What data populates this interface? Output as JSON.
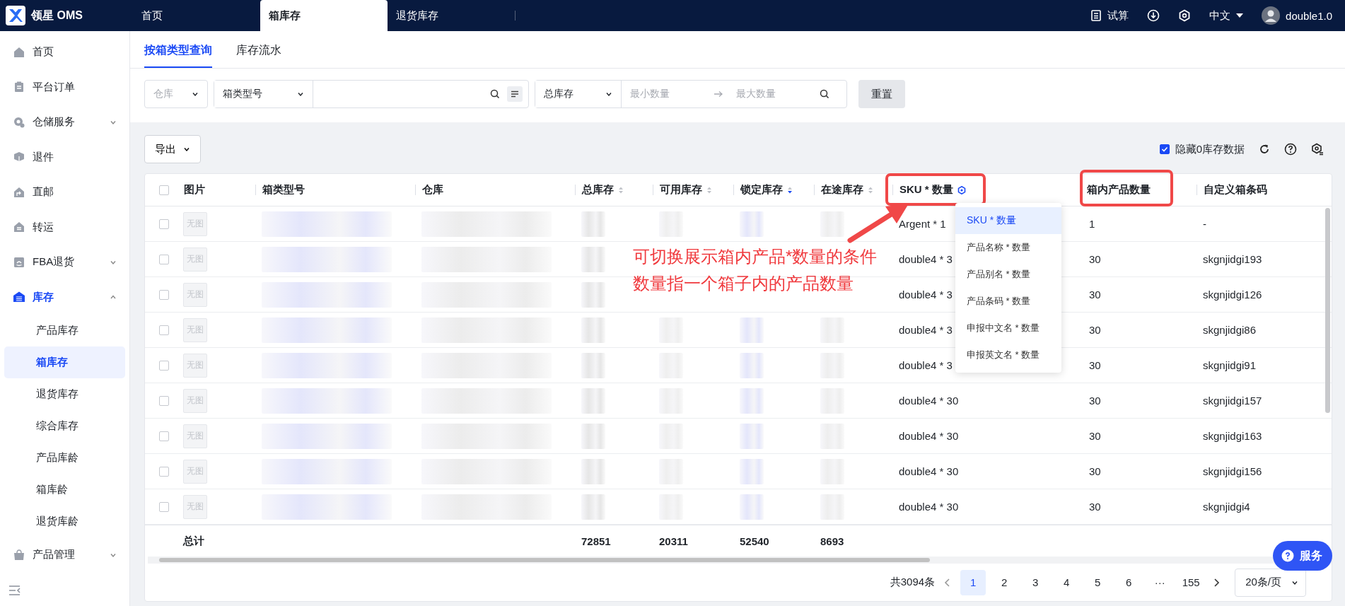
{
  "app": {
    "logo_text": "领星 OMS"
  },
  "top_tabs": [
    {
      "label": "首页",
      "selected": false
    },
    {
      "label": "箱库存",
      "selected": true
    },
    {
      "label": "退货库存",
      "selected": false
    }
  ],
  "top_actions": {
    "calc": "试算",
    "language": "中文",
    "user": "double1.0"
  },
  "sidebar": {
    "items": [
      {
        "label": "首页",
        "selected": false
      },
      {
        "label": "平台订单",
        "selected": false
      },
      {
        "label": "仓储服务",
        "expanded": false,
        "selected": false
      },
      {
        "label": "退件",
        "selected": false
      },
      {
        "label": "直邮",
        "selected": false
      },
      {
        "label": "转运",
        "selected": false
      },
      {
        "label": "FBA退货",
        "expanded": false,
        "selected": false
      },
      {
        "label": "库存",
        "expanded": true,
        "selected": true,
        "children": [
          {
            "label": "产品库存",
            "selected": false
          },
          {
            "label": "箱库存",
            "selected": true
          },
          {
            "label": "退货库存",
            "selected": false
          },
          {
            "label": "综合库存",
            "selected": false
          },
          {
            "label": "产品库龄",
            "selected": false
          },
          {
            "label": "箱库龄",
            "selected": false
          },
          {
            "label": "退货库龄",
            "selected": false
          }
        ]
      },
      {
        "label": "产品管理",
        "expanded": false,
        "selected": false
      }
    ]
  },
  "sub_tabs": [
    {
      "label": "按箱类型查询",
      "selected": true
    },
    {
      "label": "库存流水",
      "selected": false
    }
  ],
  "filters": {
    "warehouse_placeholder": "仓库",
    "field_select": "箱类型号",
    "total_select": "总库存",
    "min_placeholder": "最小数量",
    "max_placeholder": "最大数量",
    "reset": "重置"
  },
  "toolbar": {
    "export": "导出",
    "hide_zero": {
      "label": "隐藏0库存数据",
      "checked": true
    }
  },
  "table": {
    "select_all_checked": false,
    "columns": [
      {
        "label": "图片"
      },
      {
        "label": "箱类型号"
      },
      {
        "label": "仓库"
      },
      {
        "label": "总库存",
        "sortable": true,
        "sorted_desc": false
      },
      {
        "label": "可用库存",
        "sortable": true,
        "sorted_desc": false
      },
      {
        "label": "锁定库存",
        "sortable": true,
        "sorted_desc": true
      },
      {
        "label": "在途库存",
        "sortable": true,
        "sorted_desc": false
      },
      {
        "label": "SKU * 数量",
        "switchable": true
      },
      {
        "label": "箱内产品数量"
      },
      {
        "label": "自定义箱条码"
      }
    ],
    "rows": [
      {
        "checked": false,
        "image": "无图",
        "sku_qty": "Argent * 1",
        "box_qty": "1",
        "custom_barcode": "-"
      },
      {
        "checked": false,
        "image": "无图",
        "sku_qty": "double4 * 3",
        "box_qty": "30",
        "custom_barcode": "skgnjidgi193"
      },
      {
        "checked": false,
        "image": "无图",
        "sku_qty": "double4 * 3",
        "box_qty": "30",
        "custom_barcode": "skgnjidgi126"
      },
      {
        "checked": false,
        "image": "无图",
        "sku_qty": "double4 * 3",
        "box_qty": "30",
        "custom_barcode": "skgnjidgi86"
      },
      {
        "checked": false,
        "image": "无图",
        "sku_qty": "double4 * 3",
        "box_qty": "30",
        "custom_barcode": "skgnjidgi91"
      },
      {
        "checked": false,
        "image": "无图",
        "sku_qty": "double4 * 30",
        "box_qty": "30",
        "custom_barcode": "skgnjidgi157"
      },
      {
        "checked": false,
        "image": "无图",
        "sku_qty": "double4 * 30",
        "box_qty": "30",
        "custom_barcode": "skgnjidgi163"
      },
      {
        "checked": false,
        "image": "无图",
        "sku_qty": "double4 * 30",
        "box_qty": "30",
        "custom_barcode": "skgnjidgi156"
      },
      {
        "checked": false,
        "image": "无图",
        "sku_qty": "double4 * 30",
        "box_qty": "30",
        "custom_barcode": "skgnjidgi4"
      }
    ],
    "totals": {
      "label": "总计",
      "values": [
        "72851",
        "20311",
        "52540",
        "8693"
      ]
    }
  },
  "dropdown": {
    "items": [
      {
        "label": "SKU * 数量",
        "selected": true
      },
      {
        "label": "产品名称 * 数量",
        "selected": false
      },
      {
        "label": "产品别名 * 数量",
        "selected": false
      },
      {
        "label": "产品条码 * 数量",
        "selected": false
      },
      {
        "label": "申报中文名 * 数量",
        "selected": false
      },
      {
        "label": "申报英文名 * 数量",
        "selected": false
      }
    ]
  },
  "annotation": {
    "lines": [
      "可切换展示箱内产品*数量的条件",
      "数量指一个箱子内的产品数量"
    ]
  },
  "pagination": {
    "total": "共3094条",
    "pages": [
      {
        "label": "1",
        "selected": true
      },
      {
        "label": "2",
        "selected": false
      },
      {
        "label": "3",
        "selected": false
      },
      {
        "label": "4",
        "selected": false
      },
      {
        "label": "5",
        "selected": false
      },
      {
        "label": "6",
        "selected": false
      }
    ],
    "ellipsis": "···",
    "last": "155",
    "page_size": "20条/页"
  },
  "service_button": "服务"
}
